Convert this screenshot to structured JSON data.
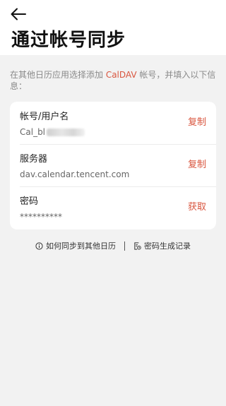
{
  "header": {
    "back_icon": "arrow-left-icon",
    "title": "通过帐号同步"
  },
  "description": {
    "before": "在其他日历应用选择添加 ",
    "highlight": "CalDAV",
    "after": " 帐号，并填入以下信息："
  },
  "accent_color": "#d9553e",
  "credentials": {
    "username": {
      "label": "帐号/用户名",
      "value": "Cal_bl",
      "action": "复制"
    },
    "server": {
      "label": "服务器",
      "value": "dav.calendar.tencent.com",
      "action": "复制"
    },
    "password": {
      "label": "密码",
      "value": "**********",
      "action": "获取"
    }
  },
  "footer_links": {
    "help": {
      "icon": "info-circle-icon",
      "label": "如何同步到其他日历"
    },
    "records": {
      "icon": "document-clock-icon",
      "label": "密码生成记录"
    }
  }
}
